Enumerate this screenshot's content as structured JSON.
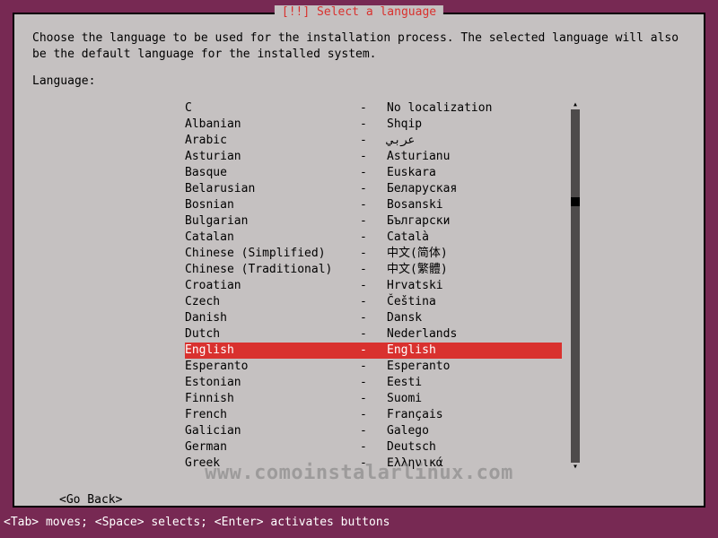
{
  "dialog": {
    "title": "[!!] Select a language",
    "prompt": "Choose the language to be used for the installation process. The selected language will also be the default language for the installed system.",
    "label": "Language:",
    "go_back": "<Go Back>"
  },
  "languages": [
    {
      "name": "C",
      "native": "No localization",
      "selected": false
    },
    {
      "name": "Albanian",
      "native": "Shqip",
      "selected": false
    },
    {
      "name": "Arabic",
      "native": "عربي",
      "selected": false
    },
    {
      "name": "Asturian",
      "native": "Asturianu",
      "selected": false
    },
    {
      "name": "Basque",
      "native": "Euskara",
      "selected": false
    },
    {
      "name": "Belarusian",
      "native": "Беларуская",
      "selected": false
    },
    {
      "name": "Bosnian",
      "native": "Bosanski",
      "selected": false
    },
    {
      "name": "Bulgarian",
      "native": "Български",
      "selected": false
    },
    {
      "name": "Catalan",
      "native": "Català",
      "selected": false
    },
    {
      "name": "Chinese (Simplified)",
      "native": "中文(简体)",
      "selected": false
    },
    {
      "name": "Chinese (Traditional)",
      "native": "中文(繁體)",
      "selected": false
    },
    {
      "name": "Croatian",
      "native": "Hrvatski",
      "selected": false
    },
    {
      "name": "Czech",
      "native": "Čeština",
      "selected": false
    },
    {
      "name": "Danish",
      "native": "Dansk",
      "selected": false
    },
    {
      "name": "Dutch",
      "native": "Nederlands",
      "selected": false
    },
    {
      "name": "English",
      "native": "English",
      "selected": true
    },
    {
      "name": "Esperanto",
      "native": "Esperanto",
      "selected": false
    },
    {
      "name": "Estonian",
      "native": "Eesti",
      "selected": false
    },
    {
      "name": "Finnish",
      "native": "Suomi",
      "selected": false
    },
    {
      "name": "French",
      "native": "Français",
      "selected": false
    },
    {
      "name": "Galician",
      "native": "Galego",
      "selected": false
    },
    {
      "name": "German",
      "native": "Deutsch",
      "selected": false
    },
    {
      "name": "Greek",
      "native": "Ελληνικά",
      "selected": false
    }
  ],
  "separator": "-",
  "hint": "<Tab> moves; <Space> selects; <Enter> activates buttons",
  "watermark": "www.comoinstalarlinux.com"
}
